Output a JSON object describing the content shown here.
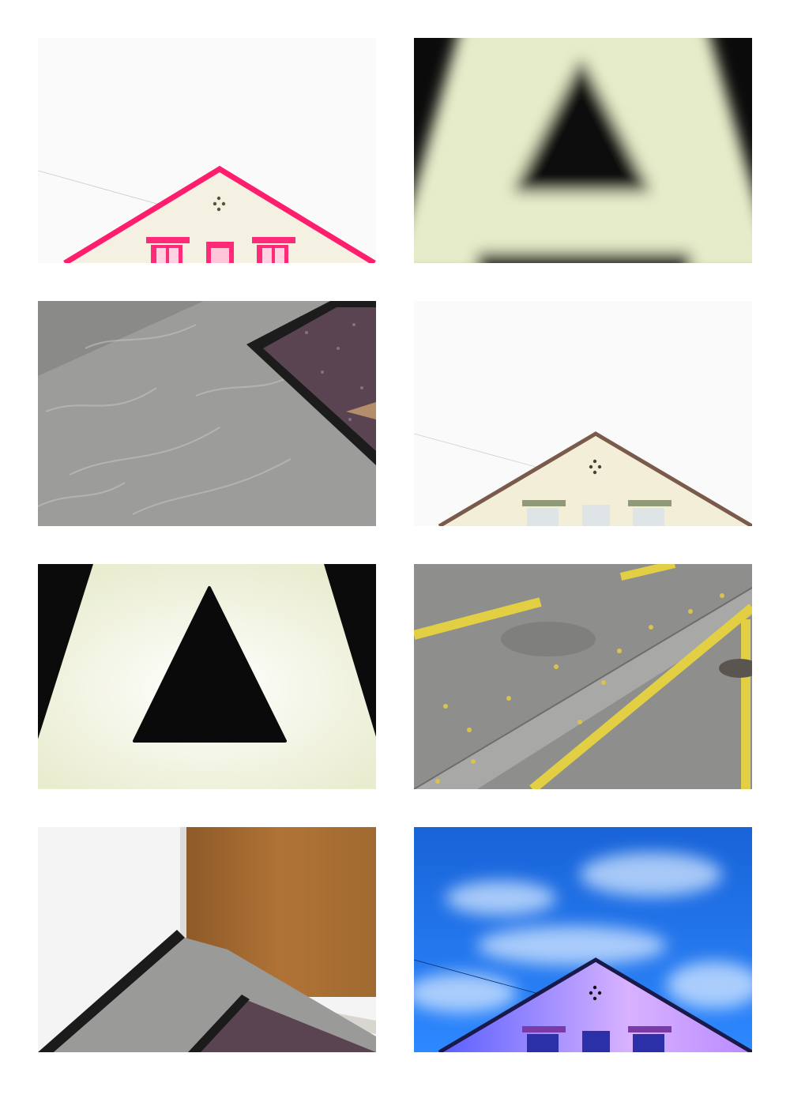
{
  "grid": {
    "columns": 2,
    "rows": 4,
    "background": "#ffffff"
  },
  "photos": [
    {
      "subject": "house-gable-pink-tinted",
      "palette": [
        "#fafafa",
        "#f5f3e6",
        "#ff1d6e"
      ]
    },
    {
      "subject": "illuminated-letter-a-blurred",
      "palette": [
        "#0b0b0b",
        "#e8edce",
        "#ffffff"
      ]
    },
    {
      "subject": "terrazzo-floor-with-doormat",
      "palette": [
        "#9a9a98",
        "#5b4451",
        "#1c1c1c"
      ]
    },
    {
      "subject": "house-gable-natural",
      "palette": [
        "#fafafa",
        "#f1ecd8",
        "#7a5a4a"
      ]
    },
    {
      "subject": "illuminated-letter-a-sharp",
      "palette": [
        "#0b0b0b",
        "#eef0d6",
        "#ffffff"
      ]
    },
    {
      "subject": "street-yellow-road-markings",
      "palette": [
        "#8d8d8b",
        "#e3cf43",
        "#a9a9a7"
      ]
    },
    {
      "subject": "wall-corner-wooden-door-and-mat",
      "palette": [
        "#f3f3f3",
        "#a86a2f",
        "#1b1b1b"
      ]
    },
    {
      "subject": "house-gable-blue-sky",
      "palette": [
        "#1a6fe0",
        "#cde2ff",
        "#b68cff"
      ]
    }
  ]
}
